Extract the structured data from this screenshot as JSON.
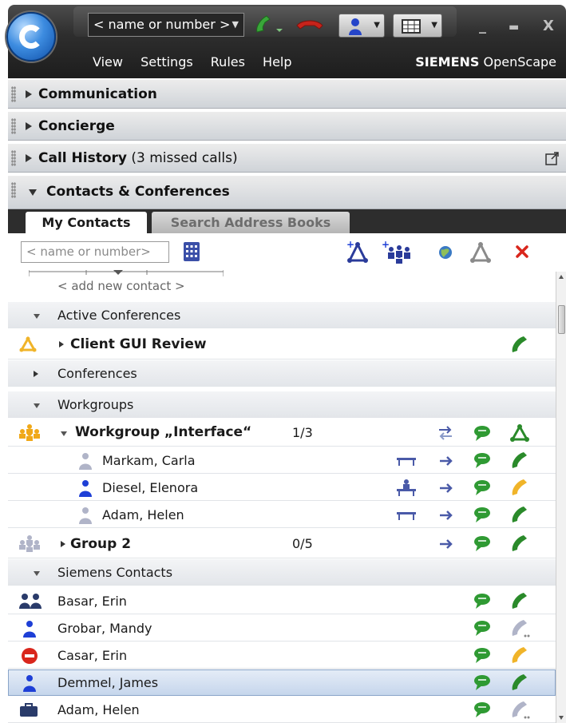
{
  "titlebar": {
    "call_placeholder": "< name or number >",
    "menu": [
      "View",
      "Settings",
      "Rules",
      "Help"
    ],
    "brand_bold": "SIEMENS",
    "brand_rest": " OpenScape",
    "minimize_glyph": "_",
    "maximize_glyph": "▬",
    "close_glyph": "X"
  },
  "sections": {
    "communication": "Communication",
    "concierge": "Concierge",
    "call_history": "Call History",
    "call_history_note": " (3 missed calls)",
    "contacts": "Contacts & Conferences"
  },
  "tabs": {
    "my_contacts": "My Contacts",
    "search_address_books": "Search Address Books"
  },
  "toolbar": {
    "search_placeholder": "< name or number>"
  },
  "list": {
    "add_new": "< add new contact >",
    "active_conferences": "Active Conferences",
    "client_gui_review": "Client GUI Review",
    "conferences": "Conferences",
    "workgroups": "Workgroups",
    "workgroup_interface": "Workgroup „Interface“",
    "workgroup_interface_count": "1/3",
    "markam": "Markam, Carla",
    "diesel": "Diesel, Elenora",
    "adam_wg": "Adam, Helen",
    "group2": "Group 2",
    "group2_count": "0/5",
    "siemens_contacts": "Siemens Contacts",
    "basar": "Basar, Erin",
    "grobar": "Grobar, Mandy",
    "casar": "Casar, Erin",
    "demmel": "Demmel, James",
    "adam": "Adam, Helen"
  },
  "colors": {
    "title_bar": "#1d1d1d",
    "section_header": "#d9dce0",
    "phone_green": "#2a8a2a",
    "phone_orange": "#f0b429",
    "phone_grey": "#b0b4c8",
    "chat_green": "#2f9a33",
    "presence_blue": "#1e3fd6",
    "busy_red": "#d9261c",
    "selection": "#c6d6ec"
  }
}
